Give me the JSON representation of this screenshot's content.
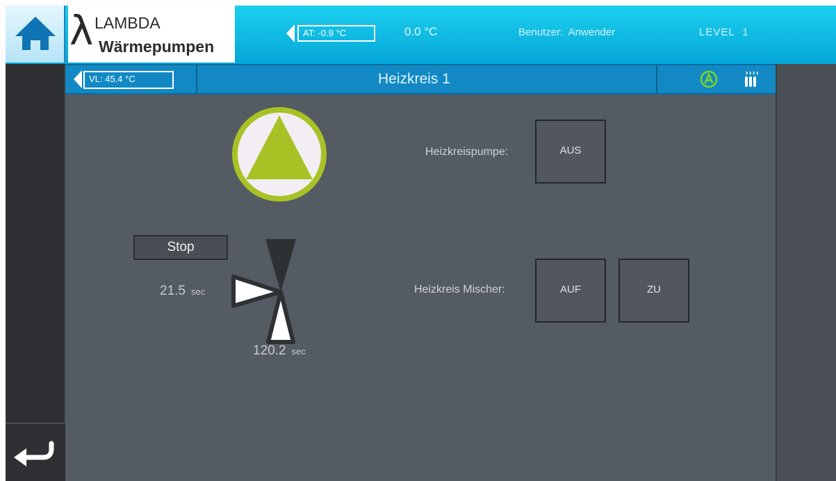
{
  "header": {
    "logo_top": "LAMBDA",
    "logo_bottom": "Wärmepumpen",
    "at_label": "AT: -0.9 °C",
    "outdoor_temp": "0.0 °C",
    "user": "Benutzer: Anwender",
    "level": "LEVEL 1"
  },
  "title_bar": {
    "vl_label": "VL: 45.4 °C",
    "title": "Heizkreis 1"
  },
  "main": {
    "stop_label": "Stop",
    "left_sec_value": "21.5",
    "bottom_sec_value": "120.2",
    "sec_unit": "sec",
    "pump_label": "Heizkreispumpe:",
    "pump_button": "AUS",
    "mixer_label": "Heizkreis Mischer:",
    "mixer_open_button": "AUF",
    "mixer_close_button": "ZU"
  },
  "icons": {
    "home": "home-icon",
    "back": "return-arrow-icon",
    "auto": "auto-mode-icon",
    "radiator": "radiator-icon",
    "pump": "pump-icon",
    "mixer": "mixing-valve-icon"
  },
  "colors": {
    "header": "#0fbfe6",
    "title_bar": "#1289c4",
    "content_bg": "#555b62",
    "pump_green": "#a8c226",
    "auto_green": "#7ed321"
  }
}
